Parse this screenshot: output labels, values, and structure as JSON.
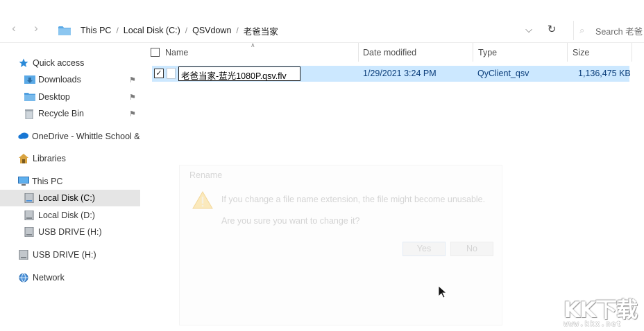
{
  "address_bar": {
    "segments": [
      "This PC",
      "Local Disk (C:)",
      "QSVdown",
      "老爸当家"
    ],
    "search_placeholder": "Search 老爸"
  },
  "sidebar": {
    "items": [
      {
        "label": "Quick access",
        "icon": "star-icon",
        "pinned": false
      },
      {
        "label": "Downloads",
        "icon": "download-folder-icon",
        "pinned": true
      },
      {
        "label": "Desktop",
        "icon": "desktop-folder-icon",
        "pinned": true
      },
      {
        "label": "Recycle Bin",
        "icon": "recycle-bin-icon",
        "pinned": true
      },
      {
        "label": "OneDrive - Whittle School &",
        "icon": "cloud-icon",
        "pinned": false
      },
      {
        "label": "Libraries",
        "icon": "library-icon",
        "pinned": false
      },
      {
        "label": "This PC",
        "icon": "computer-icon",
        "pinned": false
      },
      {
        "label": "Local Disk (C:)",
        "icon": "drive-icon",
        "pinned": false,
        "selected": true
      },
      {
        "label": "Local Disk (D:)",
        "icon": "drive-icon",
        "pinned": false
      },
      {
        "label": "USB DRIVE (H:)",
        "icon": "usb-drive-icon",
        "pinned": false
      },
      {
        "label": "USB DRIVE (H:)",
        "icon": "usb-drive-icon",
        "pinned": false
      },
      {
        "label": "Network",
        "icon": "network-icon",
        "pinned": false
      }
    ]
  },
  "columns": {
    "name": "Name",
    "date_modified": "Date modified",
    "type": "Type",
    "size": "Size"
  },
  "file": {
    "rename_value": "老爸当家-蓝光1080P.qsv.flv",
    "date_modified": "1/29/2021 3:24 PM",
    "type": "QyClient_qsv",
    "size": "1,136,475 KB"
  },
  "dialog": {
    "title": "Rename",
    "message1": "If you change a file name extension, the file might become unusable.",
    "message2": "Are you sure you want to change it?",
    "yes_label": "Yes",
    "no_label": "No"
  },
  "watermark": {
    "logo": "KK下载",
    "url": "www.kkx.net"
  },
  "colors": {
    "selection": "#cce8ff",
    "folder": "#5aa9e6",
    "accent": "#0a3d7a"
  }
}
